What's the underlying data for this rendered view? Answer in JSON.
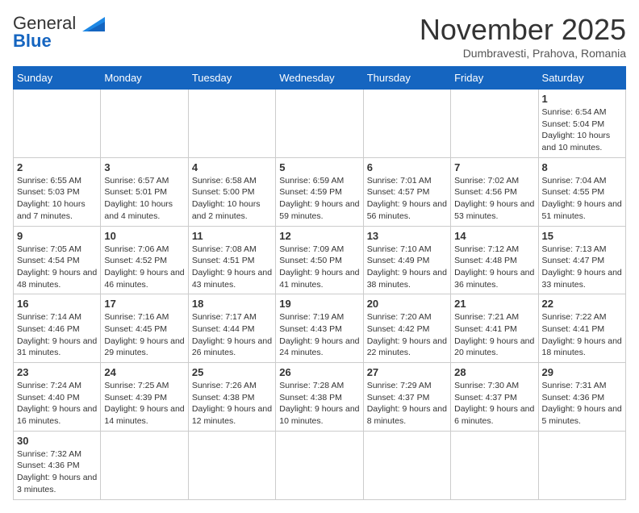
{
  "logo": {
    "general": "General",
    "blue": "Blue"
  },
  "title": "November 2025",
  "location": "Dumbravesti, Prahova, Romania",
  "days_of_week": [
    "Sunday",
    "Monday",
    "Tuesday",
    "Wednesday",
    "Thursday",
    "Friday",
    "Saturday"
  ],
  "weeks": [
    [
      {
        "day": "",
        "info": ""
      },
      {
        "day": "",
        "info": ""
      },
      {
        "day": "",
        "info": ""
      },
      {
        "day": "",
        "info": ""
      },
      {
        "day": "",
        "info": ""
      },
      {
        "day": "",
        "info": ""
      },
      {
        "day": "1",
        "info": "Sunrise: 6:54 AM\nSunset: 5:04 PM\nDaylight: 10 hours and 10 minutes."
      }
    ],
    [
      {
        "day": "2",
        "info": "Sunrise: 6:55 AM\nSunset: 5:03 PM\nDaylight: 10 hours and 7 minutes."
      },
      {
        "day": "3",
        "info": "Sunrise: 6:57 AM\nSunset: 5:01 PM\nDaylight: 10 hours and 4 minutes."
      },
      {
        "day": "4",
        "info": "Sunrise: 6:58 AM\nSunset: 5:00 PM\nDaylight: 10 hours and 2 minutes."
      },
      {
        "day": "5",
        "info": "Sunrise: 6:59 AM\nSunset: 4:59 PM\nDaylight: 9 hours and 59 minutes."
      },
      {
        "day": "6",
        "info": "Sunrise: 7:01 AM\nSunset: 4:57 PM\nDaylight: 9 hours and 56 minutes."
      },
      {
        "day": "7",
        "info": "Sunrise: 7:02 AM\nSunset: 4:56 PM\nDaylight: 9 hours and 53 minutes."
      },
      {
        "day": "8",
        "info": "Sunrise: 7:04 AM\nSunset: 4:55 PM\nDaylight: 9 hours and 51 minutes."
      }
    ],
    [
      {
        "day": "9",
        "info": "Sunrise: 7:05 AM\nSunset: 4:54 PM\nDaylight: 9 hours and 48 minutes."
      },
      {
        "day": "10",
        "info": "Sunrise: 7:06 AM\nSunset: 4:52 PM\nDaylight: 9 hours and 46 minutes."
      },
      {
        "day": "11",
        "info": "Sunrise: 7:08 AM\nSunset: 4:51 PM\nDaylight: 9 hours and 43 minutes."
      },
      {
        "day": "12",
        "info": "Sunrise: 7:09 AM\nSunset: 4:50 PM\nDaylight: 9 hours and 41 minutes."
      },
      {
        "day": "13",
        "info": "Sunrise: 7:10 AM\nSunset: 4:49 PM\nDaylight: 9 hours and 38 minutes."
      },
      {
        "day": "14",
        "info": "Sunrise: 7:12 AM\nSunset: 4:48 PM\nDaylight: 9 hours and 36 minutes."
      },
      {
        "day": "15",
        "info": "Sunrise: 7:13 AM\nSunset: 4:47 PM\nDaylight: 9 hours and 33 minutes."
      }
    ],
    [
      {
        "day": "16",
        "info": "Sunrise: 7:14 AM\nSunset: 4:46 PM\nDaylight: 9 hours and 31 minutes."
      },
      {
        "day": "17",
        "info": "Sunrise: 7:16 AM\nSunset: 4:45 PM\nDaylight: 9 hours and 29 minutes."
      },
      {
        "day": "18",
        "info": "Sunrise: 7:17 AM\nSunset: 4:44 PM\nDaylight: 9 hours and 26 minutes."
      },
      {
        "day": "19",
        "info": "Sunrise: 7:19 AM\nSunset: 4:43 PM\nDaylight: 9 hours and 24 minutes."
      },
      {
        "day": "20",
        "info": "Sunrise: 7:20 AM\nSunset: 4:42 PM\nDaylight: 9 hours and 22 minutes."
      },
      {
        "day": "21",
        "info": "Sunrise: 7:21 AM\nSunset: 4:41 PM\nDaylight: 9 hours and 20 minutes."
      },
      {
        "day": "22",
        "info": "Sunrise: 7:22 AM\nSunset: 4:41 PM\nDaylight: 9 hours and 18 minutes."
      }
    ],
    [
      {
        "day": "23",
        "info": "Sunrise: 7:24 AM\nSunset: 4:40 PM\nDaylight: 9 hours and 16 minutes."
      },
      {
        "day": "24",
        "info": "Sunrise: 7:25 AM\nSunset: 4:39 PM\nDaylight: 9 hours and 14 minutes."
      },
      {
        "day": "25",
        "info": "Sunrise: 7:26 AM\nSunset: 4:38 PM\nDaylight: 9 hours and 12 minutes."
      },
      {
        "day": "26",
        "info": "Sunrise: 7:28 AM\nSunset: 4:38 PM\nDaylight: 9 hours and 10 minutes."
      },
      {
        "day": "27",
        "info": "Sunrise: 7:29 AM\nSunset: 4:37 PM\nDaylight: 9 hours and 8 minutes."
      },
      {
        "day": "28",
        "info": "Sunrise: 7:30 AM\nSunset: 4:37 PM\nDaylight: 9 hours and 6 minutes."
      },
      {
        "day": "29",
        "info": "Sunrise: 7:31 AM\nSunset: 4:36 PM\nDaylight: 9 hours and 5 minutes."
      }
    ],
    [
      {
        "day": "30",
        "info": "Sunrise: 7:32 AM\nSunset: 4:36 PM\nDaylight: 9 hours and 3 minutes."
      },
      {
        "day": "",
        "info": ""
      },
      {
        "day": "",
        "info": ""
      },
      {
        "day": "",
        "info": ""
      },
      {
        "day": "",
        "info": ""
      },
      {
        "day": "",
        "info": ""
      },
      {
        "day": "",
        "info": ""
      }
    ]
  ]
}
